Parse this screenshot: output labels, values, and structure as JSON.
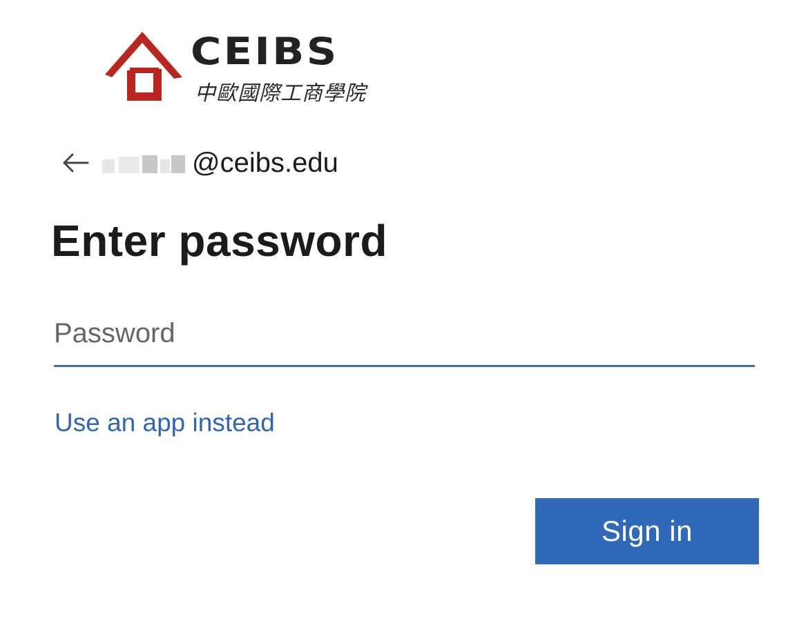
{
  "logo": {
    "wordmark": "CEIBS",
    "subtitle": "中歐國際工商學院",
    "mark_color": "#b8261f",
    "wordmark_color": "#222222"
  },
  "identity": {
    "back_icon": "arrow-left-icon",
    "email_visible_suffix": "@ceibs.edu"
  },
  "heading": "Enter password",
  "password_field": {
    "placeholder": "Password",
    "value": ""
  },
  "alt_signin_link": "Use an app instead",
  "signin_button": "Sign in",
  "colors": {
    "accent": "#2f69b8",
    "link": "#2e66b5",
    "text": "#1b1b1b"
  }
}
